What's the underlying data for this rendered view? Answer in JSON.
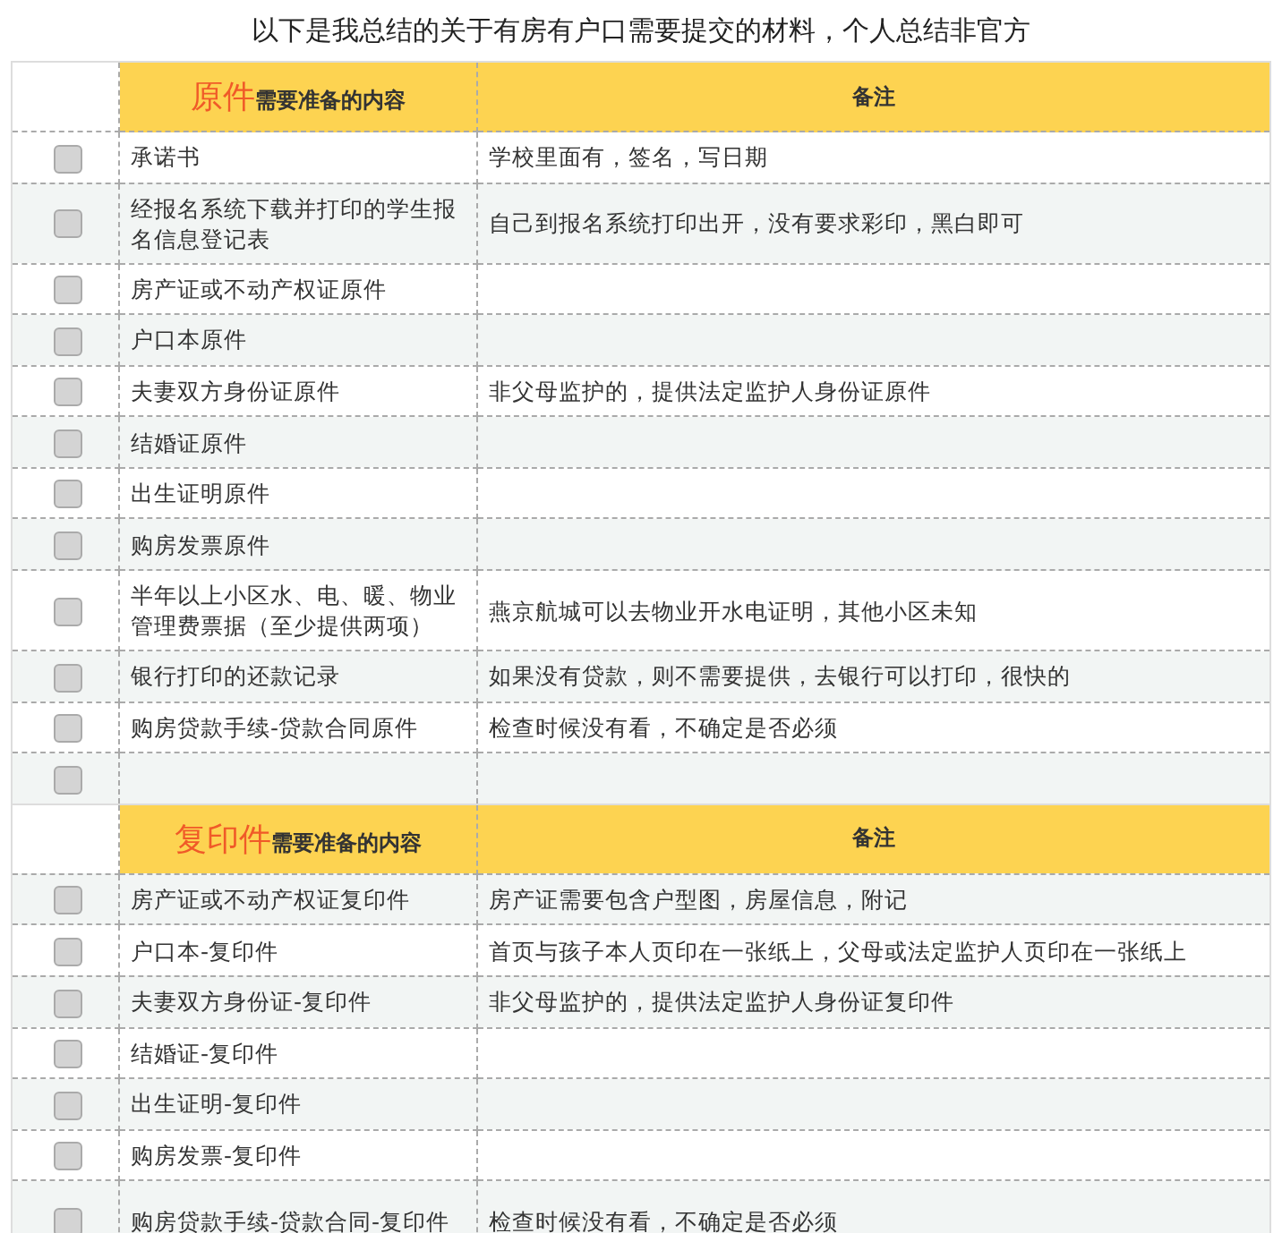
{
  "title": "以下是我总结的关于有房有户口需要提交的材料，个人总结非官方",
  "sections": [
    {
      "header": {
        "emphasis": "原件",
        "rest": "需要准备的内容",
        "note": "备注"
      },
      "rows": [
        {
          "checked": false,
          "item": "承诺书",
          "note": "学校里面有，签名，写日期"
        },
        {
          "checked": false,
          "item": "经报名系统下载并打印的学生报名信息登记表",
          "note": "自己到报名系统打印出开，没有要求彩印，黑白即可"
        },
        {
          "checked": false,
          "item": "房产证或不动产权证原件"
        },
        {
          "checked": false,
          "item": "户口本原件"
        },
        {
          "checked": false,
          "item": "夫妻双方身份证原件",
          "note": "非父母监护的，提供法定监护人身份证原件"
        },
        {
          "checked": false,
          "item": "结婚证原件"
        },
        {
          "checked": false,
          "item": "出生证明原件"
        },
        {
          "checked": false,
          "item": "购房发票原件"
        },
        {
          "checked": false,
          "item": "半年以上小区水、电、暖、物业管理费票据（至少提供两项）",
          "note": "燕京航城可以去物业开水电证明，其他小区未知"
        },
        {
          "checked": false,
          "item": "银行打印的还款记录",
          "note": "如果没有贷款，则不需要提供，去银行可以打印，很快的"
        },
        {
          "checked": false,
          "item": "购房贷款手续-贷款合同原件",
          "note": "检查时候没有看，不确定是否必须"
        },
        {
          "checked": false
        }
      ]
    },
    {
      "header": {
        "emphasis": "复印件",
        "rest": "需要准备的内容",
        "note": "备注"
      },
      "rows": [
        {
          "checked": false,
          "item": "房产证或不动产权证复印件",
          "note": "房产证需要包含户型图，房屋信息，附记"
        },
        {
          "checked": false,
          "item": "户口本-复印件",
          "note": "首页与孩子本人页印在一张纸上，父母或法定监护人页印在一张纸上"
        },
        {
          "checked": false,
          "item": "夫妻双方身份证-复印件",
          "note": "非父母监护的，提供法定监护人身份证复印件"
        },
        {
          "checked": false,
          "item": "结婚证-复印件"
        },
        {
          "checked": false,
          "item": "出生证明-复印件"
        },
        {
          "checked": false,
          "item": "购房发票-复印件"
        },
        {
          "checked": false,
          "item": "购房贷款手续-贷款合同-复印件",
          "note": "检查时候没有看，不确定是否必须"
        }
      ]
    }
  ]
}
